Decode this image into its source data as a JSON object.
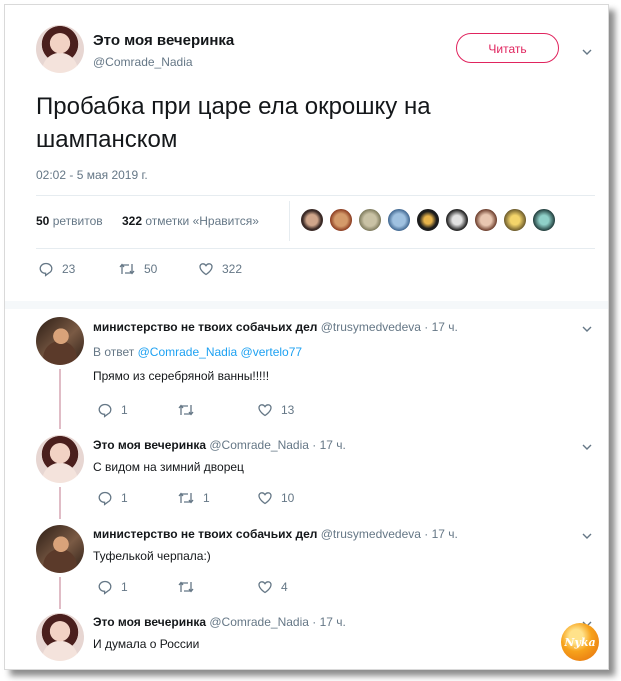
{
  "tweet": {
    "author_name": "Это моя вечеринка",
    "author_handle": "@Comrade_Nadia",
    "follow_label": "Читать",
    "text": "Пробабка при царе ела окрошку на шампанском",
    "timestamp": "02:02 - 5 мая 2019 г.",
    "retweets_count": "50",
    "retweets_label": "ретвитов",
    "likes_count": "322",
    "likes_label": "отметки «Нравится»",
    "actions": {
      "replies": "23",
      "retweets": "50",
      "likes": "322"
    }
  },
  "replies": [
    {
      "author_name": "министерство не твоих собачьих дел",
      "author_handle": "@trusymedvedeva",
      "time": "· 17 ч.",
      "reply_to_prefix": "В ответ",
      "reply_to": "@Comrade_Nadia @vertelo77",
      "text": "Прямо из серебряной ванны!!!!!",
      "replies": "1",
      "retweets": "",
      "likes": "13",
      "avatar": "man"
    },
    {
      "author_name": "Это моя вечеринка",
      "author_handle": "@Comrade_Nadia",
      "time": "· 17 ч.",
      "text": "С видом на зимний дворец",
      "replies": "1",
      "retweets": "1",
      "likes": "10",
      "avatar": "woman"
    },
    {
      "author_name": "министерство не твоих собачьих дел",
      "author_handle": "@trusymedvedeva",
      "time": "· 17 ч.",
      "text": "Туфелькой черпала:)",
      "replies": "1",
      "retweets": "",
      "likes": "4",
      "avatar": "man"
    },
    {
      "author_name": "Это моя вечеринка",
      "author_handle": "@Comrade_Nadia",
      "time": "· 17 ч.",
      "text": "И думала о России",
      "avatar": "woman"
    }
  ],
  "watermark": "Nyka",
  "colors": {
    "accent": "#e0245e",
    "link": "#1da1f2",
    "muted": "#657786"
  }
}
